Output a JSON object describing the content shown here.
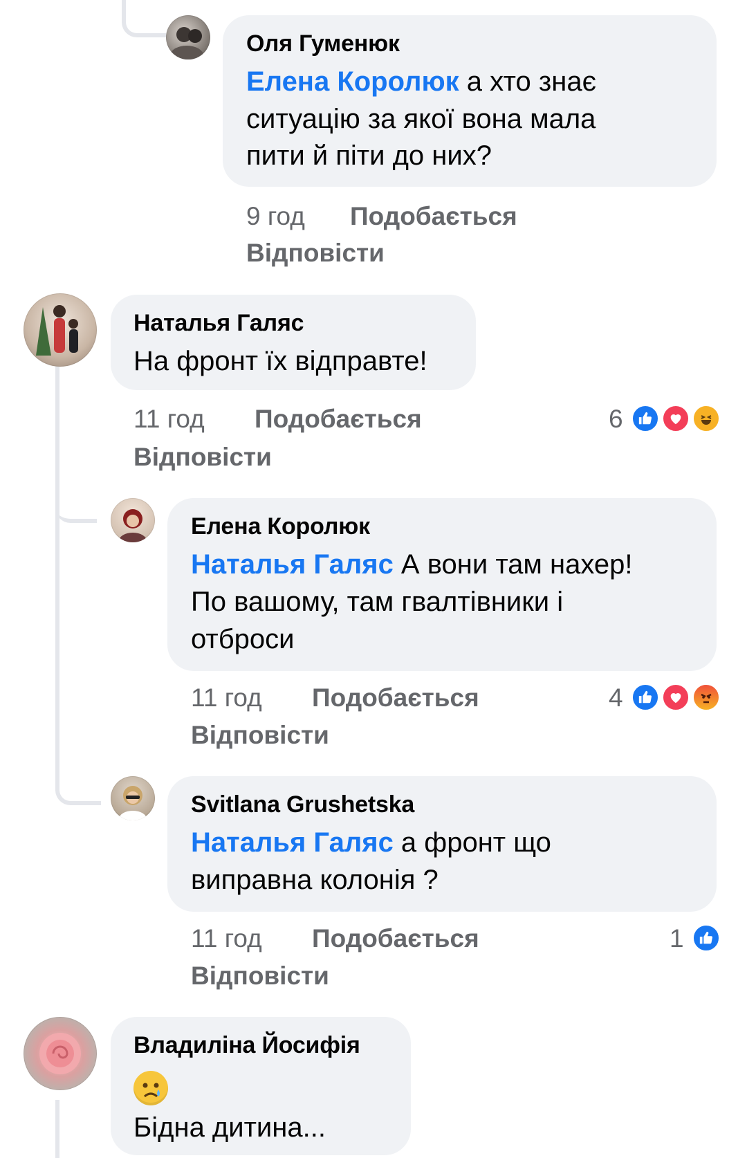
{
  "comments": [
    {
      "author": "Оля Гуменюк",
      "mention": "Елена Королюк",
      "text_line1": " а хто знає",
      "text_line2": "ситуацію за якої вона мала",
      "text_line3": "пити й піти до них?",
      "time": "9 год",
      "like_label": "Подобається",
      "reply_label": "Відповісти"
    },
    {
      "author": "Наталья Галяс",
      "text_line1": "На фронт їх відправте!",
      "time": "11 год",
      "like_label": "Подобається",
      "reply_label": "Відповісти",
      "reaction_count": "6",
      "reactions": [
        "like-icon",
        "love-icon",
        "haha-icon"
      ]
    },
    {
      "author": "Елена Королюк",
      "mention": "Наталья Галяс",
      "text_line1": " А вони там нахер!",
      "text_line2": "По вашому, там гвалтівники і",
      "text_line3": "отброси",
      "time": "11 год",
      "like_label": "Подобається",
      "reply_label": "Відповісти",
      "reaction_count": "4",
      "reactions": [
        "like-icon",
        "love-icon",
        "angry-icon"
      ]
    },
    {
      "author": "Svitlana Grushetska",
      "mention": "Наталья Галяс",
      "text_line1": " а фронт що",
      "text_line2": "виправна колонія ?",
      "time": "11 год",
      "like_label": "Подобається",
      "reply_label": "Відповісти",
      "reaction_count": "1",
      "reactions": [
        "like-icon"
      ]
    },
    {
      "author": "Владиліна Йосифія",
      "emoji": "crying-face-emoji",
      "text_line2": "Бідна дитина..."
    }
  ],
  "colors": {
    "bubble": "#f0f2f5",
    "mention": "#1877f2",
    "meta": "#65676b",
    "like": "#1877f2",
    "love": "#f33e58",
    "haha": "#f7b125"
  }
}
